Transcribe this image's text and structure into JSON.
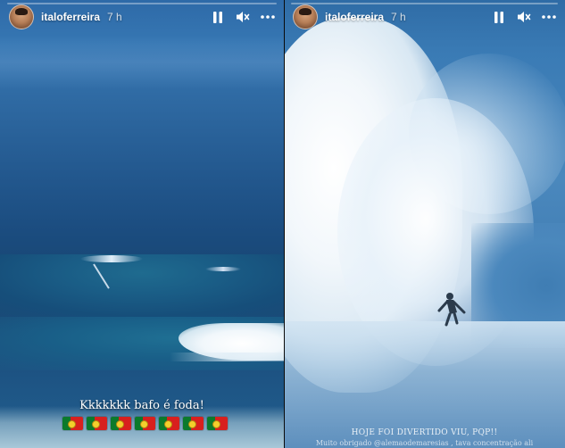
{
  "stories": [
    {
      "username": "italoferreira",
      "time": "7 h",
      "caption": "Kkkkkkk bafo é foda!",
      "flags": [
        "portugal-flag",
        "portugal-flag",
        "portugal-flag",
        "portugal-flag",
        "portugal-flag",
        "portugal-flag",
        "portugal-flag"
      ],
      "progress": 0.0,
      "controls": {
        "pause_icon": "pause-icon",
        "mute_icon": "muted-speaker-icon",
        "more_icon": "more-horizontal-icon"
      }
    },
    {
      "username": "italoferreira",
      "time": "7 h",
      "caption_line1": "HOJE FOI DIVERTIDO VIU, PQP!!",
      "caption_line2": "Muito obrigado @alemaodemaresias , tava concentração ali",
      "progress": 0.0,
      "controls": {
        "pause_icon": "pause-icon",
        "mute_icon": "muted-speaker-icon",
        "more_icon": "more-horizontal-icon"
      }
    }
  ],
  "colors": {
    "text": "#ffffff",
    "flag_green": "#0b7a2b",
    "flag_red": "#d8201e"
  }
}
